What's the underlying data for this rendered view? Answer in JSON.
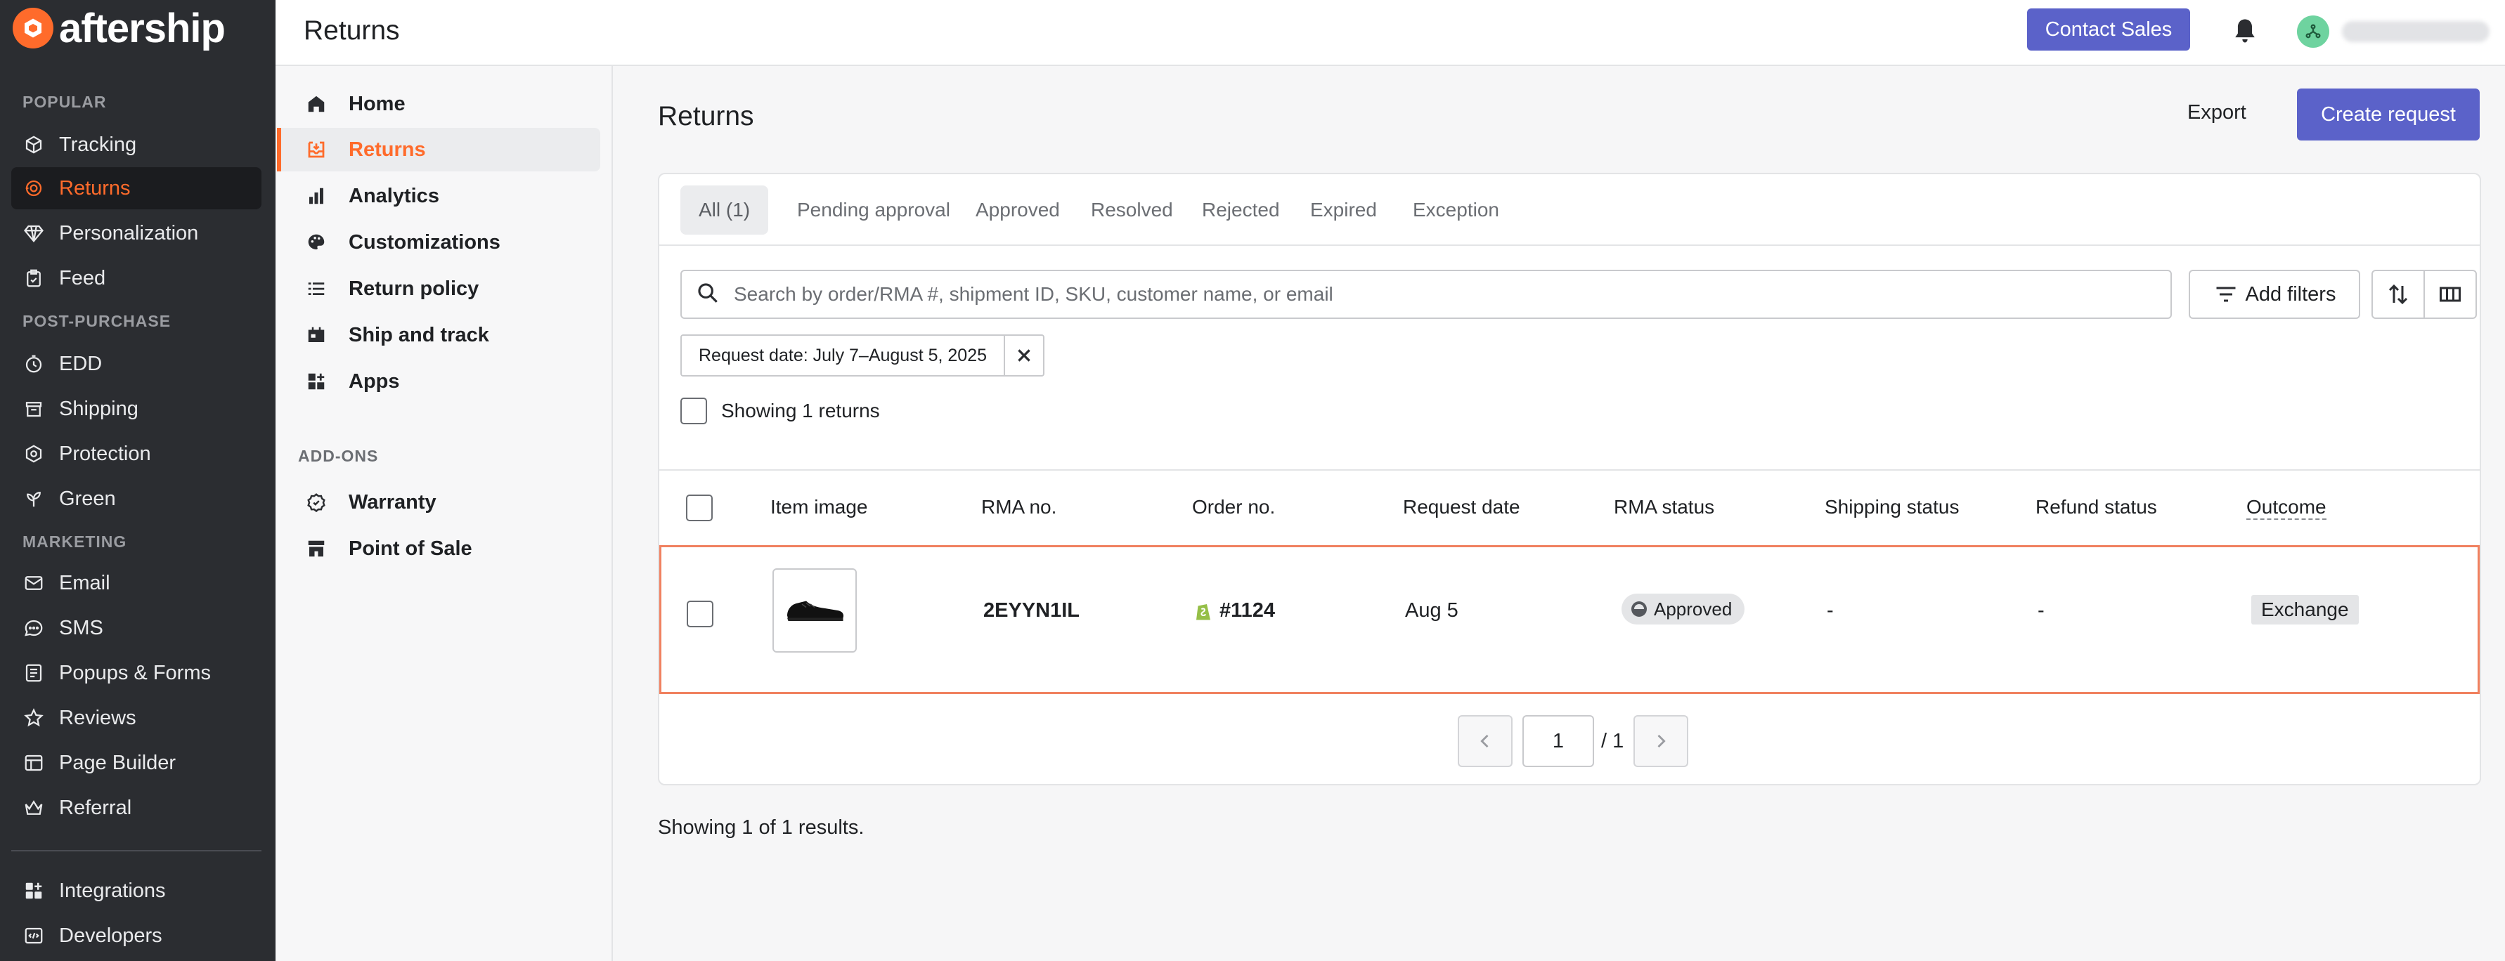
{
  "brand": {
    "name": "aftership",
    "accent": "#ff6b2b",
    "primary": "#5b62c9"
  },
  "sidebar": {
    "sections": [
      {
        "label": "POPULAR",
        "items": [
          {
            "label": "Tracking",
            "icon": "tracking-icon"
          },
          {
            "label": "Returns",
            "icon": "returns-icon",
            "active": true
          },
          {
            "label": "Personalization",
            "icon": "diamond-icon"
          },
          {
            "label": "Feed",
            "icon": "feed-icon"
          }
        ]
      },
      {
        "label": "POST-PURCHASE",
        "items": [
          {
            "label": "EDD",
            "icon": "clock-icon"
          },
          {
            "label": "Shipping",
            "icon": "shipping-icon"
          },
          {
            "label": "Protection",
            "icon": "shield-icon"
          },
          {
            "label": "Green",
            "icon": "sprout-icon"
          }
        ]
      },
      {
        "label": "MARKETING",
        "items": [
          {
            "label": "Email",
            "icon": "mail-icon"
          },
          {
            "label": "SMS",
            "icon": "chat-icon"
          },
          {
            "label": "Popups & Forms",
            "icon": "form-icon"
          },
          {
            "label": "Reviews",
            "icon": "star-icon"
          },
          {
            "label": "Page Builder",
            "icon": "page-icon"
          },
          {
            "label": "Referral",
            "icon": "crown-icon"
          }
        ]
      }
    ],
    "footer": [
      {
        "label": "Integrations",
        "icon": "grid-icon"
      },
      {
        "label": "Developers",
        "icon": "code-icon"
      }
    ]
  },
  "topbar": {
    "title": "Returns",
    "contact_label": "Contact Sales"
  },
  "subnav": {
    "items": [
      {
        "label": "Home",
        "icon": "home-icon"
      },
      {
        "label": "Returns",
        "icon": "returns-inbox-icon",
        "active": true
      },
      {
        "label": "Analytics",
        "icon": "bar-chart-icon"
      },
      {
        "label": "Customizations",
        "icon": "palette-icon"
      },
      {
        "label": "Return policy",
        "icon": "list-icon"
      },
      {
        "label": "Ship and track",
        "icon": "calendar-icon"
      },
      {
        "label": "Apps",
        "icon": "apps-icon"
      }
    ],
    "addons_label": "ADD-ONS",
    "addons": [
      {
        "label": "Warranty",
        "icon": "warranty-icon"
      },
      {
        "label": "Point of Sale",
        "icon": "store-icon"
      }
    ]
  },
  "main": {
    "title": "Returns",
    "export_label": "Export",
    "create_label": "Create request",
    "tabs": [
      "All (1)",
      "Pending approval",
      "Approved",
      "Resolved",
      "Rejected",
      "Expired",
      "Exception"
    ],
    "search_placeholder": "Search by order/RMA #, shipment ID, SKU, customer name, or email",
    "add_filters_label": "Add filters",
    "filter_chip": "Request date: July 7–August 5, 2025",
    "showing_label": "Showing 1 returns",
    "columns": [
      "Item image",
      "RMA no.",
      "Order no.",
      "Request date",
      "RMA status",
      "Shipping status",
      "Refund status",
      "Outcome"
    ],
    "rows": [
      {
        "rma": "2EYYN1IL",
        "order": "#1124",
        "date": "Aug 5",
        "rma_status": "Approved",
        "shipping_status": "-",
        "refund_status": "-",
        "outcome": "Exchange"
      }
    ],
    "pagination": {
      "current": "1",
      "total": "/ 1"
    },
    "results_text": "Showing 1 of 1 results."
  }
}
